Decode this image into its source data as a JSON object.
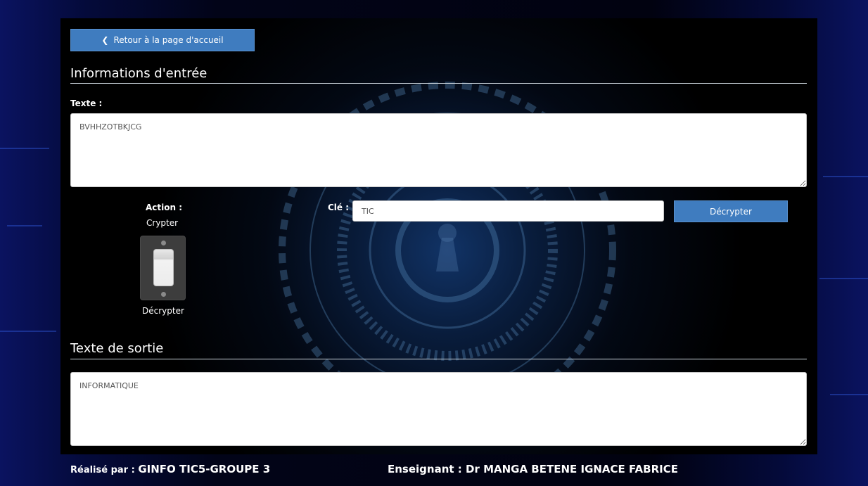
{
  "nav": {
    "back_label": "Retour à la page d'accueil"
  },
  "input_section": {
    "title": "Informations d'entrée",
    "text_label": "Texte :",
    "text_value": "BVHHZOTBKJCG"
  },
  "controls": {
    "action_label": "Action :",
    "option_top": "Crypter",
    "option_bottom": "Décrypter",
    "switch_state": "Décrypter",
    "key_label": "Clé :",
    "key_value": "TIC",
    "submit_label": "Décrypter"
  },
  "output_section": {
    "title": "Texte de sortie",
    "output_value": "INFORMATIQUE"
  },
  "footer": {
    "author_prefix": "Réalisé par : ",
    "author_value": "GINFO TIC5-GROUPE 3",
    "teacher_label": "Enseignant : Dr MANGA BETENE IGNACE FABRICE"
  },
  "colors": {
    "button": "#3f7cbf",
    "panel": "#000000",
    "background": "#02041a"
  }
}
